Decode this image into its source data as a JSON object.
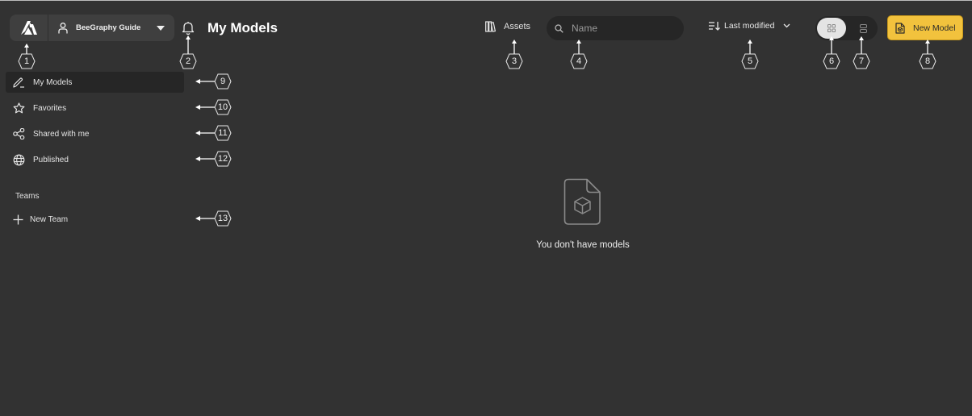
{
  "header": {
    "logo_icon": "beegraphy-logo-icon",
    "account_name": "BeeGraphy Guide",
    "account_icon": "user-icon",
    "account_dropdown_icon": "caret-down-icon",
    "notifications_icon": "bell-icon",
    "page_title": "My Models",
    "assets_label": "Assets",
    "assets_icon": "library-icon",
    "search": {
      "placeholder": "Name",
      "value": "",
      "icon": "search-icon"
    },
    "sort": {
      "label": "Last modified",
      "icon": "sort-icon",
      "dropdown_icon": "chevron-down-icon"
    },
    "view_toggle": {
      "options": [
        "grid",
        "list"
      ],
      "selected": "grid"
    },
    "new_model_label": "New Model",
    "new_model_icon": "new-model-file-icon"
  },
  "sidebar": {
    "items": [
      {
        "label": "My Models",
        "icon": "pencil-icon",
        "active": true
      },
      {
        "label": "Favorites",
        "icon": "star-icon",
        "active": false
      },
      {
        "label": "Shared with me",
        "icon": "share-icon",
        "active": false
      },
      {
        "label": "Published",
        "icon": "globe-icon",
        "active": false
      }
    ],
    "teams_heading": "Teams",
    "new_team_label": "New Team",
    "new_team_icon": "plus-icon"
  },
  "main": {
    "empty_state_icon": "file-cube-icon",
    "empty_state_text": "You don't have models"
  },
  "annotations": {
    "markers": [
      "1",
      "2",
      "3",
      "4",
      "5",
      "6",
      "7",
      "8",
      "9",
      "10",
      "11",
      "12",
      "13"
    ]
  },
  "colors": {
    "background": "#323232",
    "accent_yellow": "#f2c23d",
    "active_item_bg": "#262626"
  }
}
